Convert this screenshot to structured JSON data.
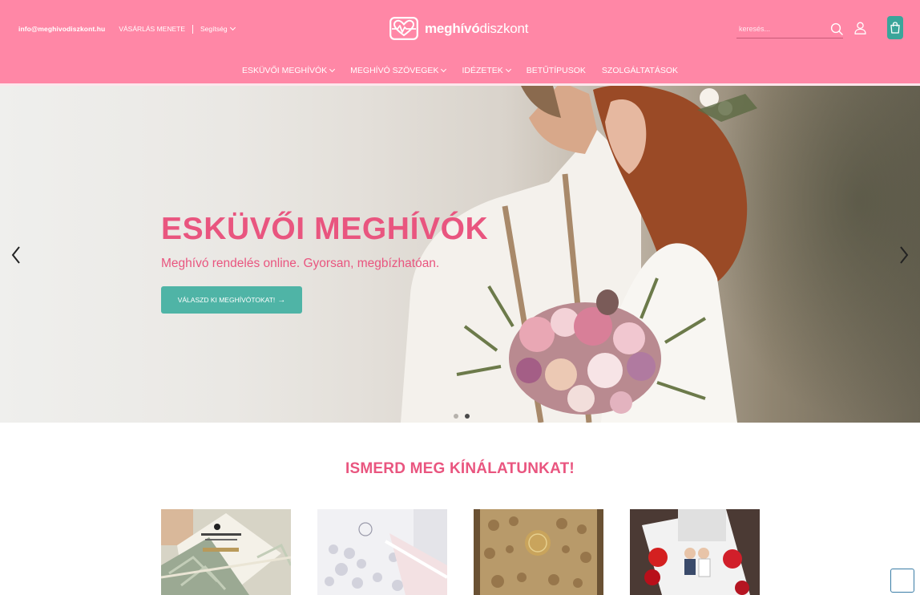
{
  "header": {
    "email": "info@meghivodiszkont.hu",
    "purchase_process": "VÁSÁRLÁS MENETE",
    "help": "Segítség",
    "logo_brand_bold": "meghívó",
    "logo_brand_light": "diszkont",
    "search_placeholder": "keresés...",
    "icons": [
      "search-icon",
      "user-icon",
      "cart-icon",
      "heart-logo-icon",
      "chevron-down-icon"
    ]
  },
  "nav": {
    "items": [
      {
        "label": "ESKÜVŐI MEGHÍVÓK",
        "dropdown": true
      },
      {
        "label": "MEGHÍVÓ SZÖVEGEK",
        "dropdown": true
      },
      {
        "label": "IDÉZETEK",
        "dropdown": true
      },
      {
        "label": "BETŰTÍPUSOK",
        "dropdown": false
      },
      {
        "label": "SZOLGÁLTATÁSOK",
        "dropdown": false
      }
    ]
  },
  "hero": {
    "title": "ESKÜVŐI MEGHÍVÓK",
    "subtitle": "Meghívó rendelés online. Gyorsan, megbízhatóan.",
    "cta_label": "VÁLASZD KI MEGHÍVÓTOKAT!",
    "cta_arrow": "→",
    "slides_count": 2,
    "active_slide": 2
  },
  "offers": {
    "title": "ISMERD MEG KÍNÁLATUNKAT!",
    "products": [
      {
        "name": "laser-cut-card-product"
      },
      {
        "name": "lace-white-card-product"
      },
      {
        "name": "gold-lace-wax-seal-product"
      },
      {
        "name": "illustrated-couple-card-product"
      }
    ]
  },
  "colors": {
    "brand_pink": "#ff87a6",
    "heading_pink": "#e9557f",
    "accent_teal": "#4fb4a6",
    "cart_teal": "#3aa59a"
  }
}
